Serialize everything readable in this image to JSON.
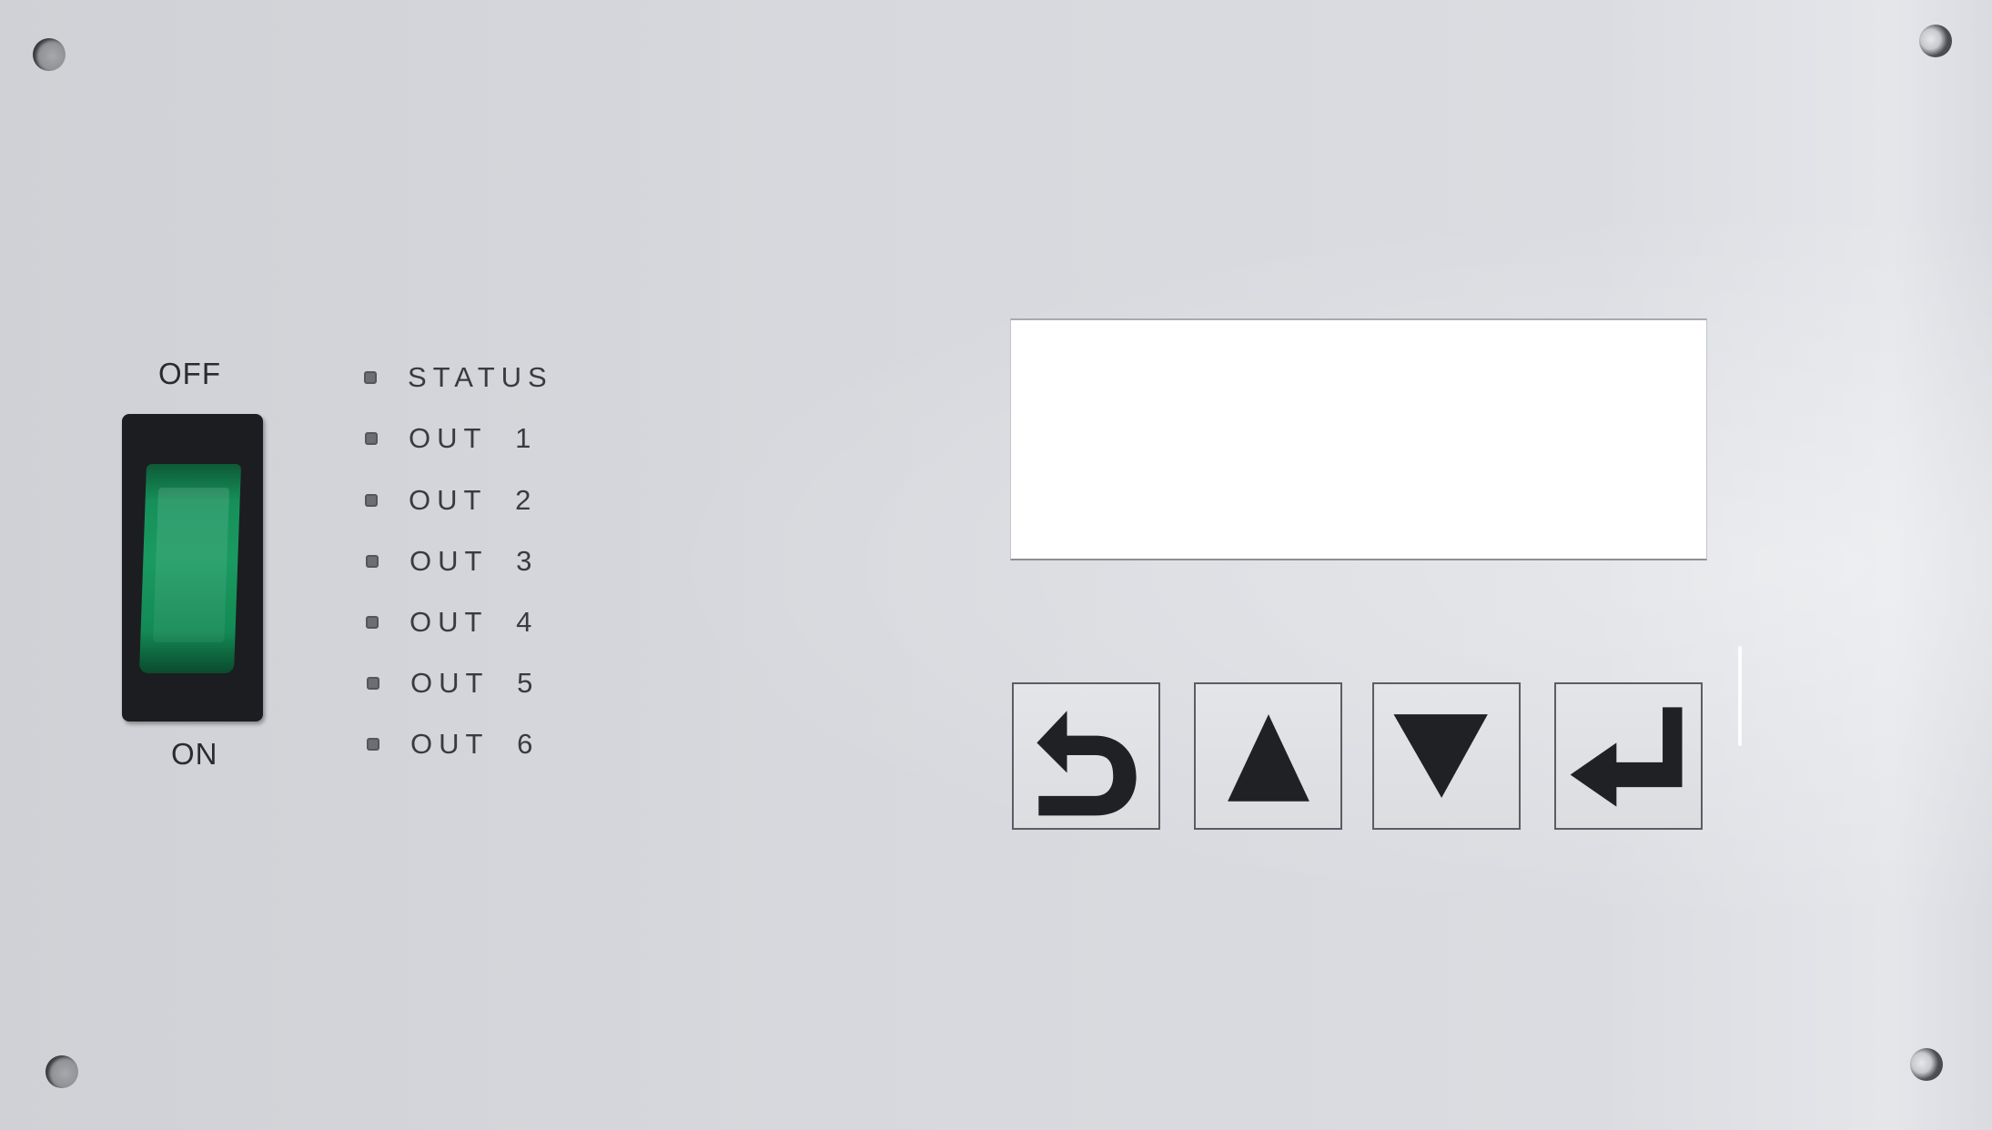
{
  "panel": {
    "type": "controller front panel",
    "colors": {
      "panel": "#d6d8dd",
      "switch_body": "#1c1d20",
      "switch_rocker": "#1a9a61",
      "display": "#ffffff",
      "label_text": "#3a3b40"
    }
  },
  "power_switch": {
    "off_label": "OFF",
    "on_label": "ON",
    "state": "ON"
  },
  "indicators": [
    {
      "label": "STATUS"
    },
    {
      "label": "OUT  1"
    },
    {
      "label": "OUT  2"
    },
    {
      "label": "OUT  3"
    },
    {
      "label": "OUT  4"
    },
    {
      "label": "OUT  5"
    },
    {
      "label": "OUT  6"
    }
  ],
  "display": {
    "text": ""
  },
  "keypad": [
    {
      "name": "back",
      "icon": "return-arrow-icon"
    },
    {
      "name": "up",
      "icon": "triangle-up-icon"
    },
    {
      "name": "down",
      "icon": "triangle-down-icon"
    },
    {
      "name": "enter",
      "icon": "enter-arrow-icon"
    }
  ]
}
